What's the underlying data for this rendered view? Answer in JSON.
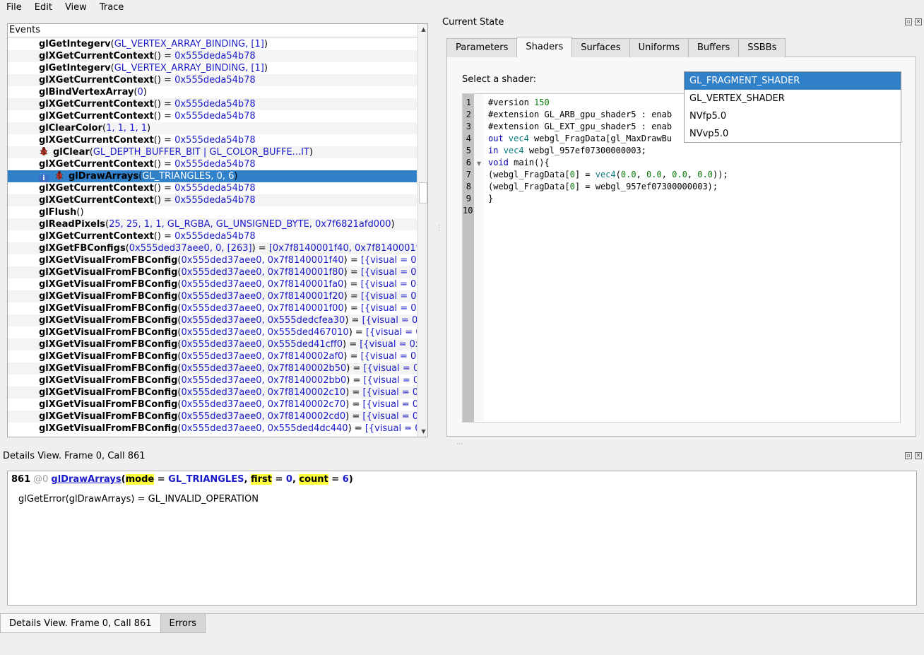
{
  "menubar": {
    "items": [
      "File",
      "Edit",
      "View",
      "Trace"
    ]
  },
  "events": {
    "header": "Events",
    "rows": [
      {
        "fn": "glGetIntegerv",
        "args": "GL_VERTEX_ARRAY_BINDING, [1]",
        "ret": ""
      },
      {
        "fn": "glXGetCurrentContext",
        "args": "",
        "ret": "0x555deda54b78"
      },
      {
        "fn": "glGetIntegerv",
        "args": "GL_VERTEX_ARRAY_BINDING, [1]",
        "ret": ""
      },
      {
        "fn": "glXGetCurrentContext",
        "args": "",
        "ret": "0x555deda54b78"
      },
      {
        "fn": "glBindVertexArray",
        "args": "0",
        "ret": ""
      },
      {
        "fn": "glXGetCurrentContext",
        "args": "",
        "ret": "0x555deda54b78"
      },
      {
        "fn": "glXGetCurrentContext",
        "args": "",
        "ret": "0x555deda54b78"
      },
      {
        "fn": "glClearColor",
        "args": "1, 1, 1, 1",
        "ret": ""
      },
      {
        "fn": "glXGetCurrentContext",
        "args": "",
        "ret": "0x555deda54b78"
      },
      {
        "fn": "glClear",
        "args": "GL_DEPTH_BUFFER_BIT | GL_COLOR_BUFFE...IT",
        "ret": "",
        "icon": "bug"
      },
      {
        "fn": "glXGetCurrentContext",
        "args": "",
        "ret": "0x555deda54b78"
      },
      {
        "fn": "glDrawArrays",
        "args": "GL_TRIANGLES, 0, 6",
        "ret": "",
        "icon": "info-bug",
        "selected": true
      },
      {
        "fn": "glXGetCurrentContext",
        "args": "",
        "ret": "0x555deda54b78"
      },
      {
        "fn": "glXGetCurrentContext",
        "args": "",
        "ret": "0x555deda54b78"
      },
      {
        "fn": "glFlush",
        "args": "",
        "ret": ""
      },
      {
        "fn": "glReadPixels",
        "args": "25, 25, 1, 1, GL_RGBA, GL_UNSIGNED_BYTE, 0x7f6821afd000",
        "ret": ""
      },
      {
        "fn": "glXGetCurrentContext",
        "args": "",
        "ret": "0x555deda54b78"
      },
      {
        "fn": "glXGetFBConfigs",
        "args": "0x555ded37aee0, 0, [263]",
        "ret": "[0x7f8140001f40, 0x7f8140001f"
      },
      {
        "fn": "glXGetVisualFromFBConfig",
        "args": "0x555ded37aee0, 0x7f8140001f40",
        "ret": "[{visual = 0"
      },
      {
        "fn": "glXGetVisualFromFBConfig",
        "args": "0x555ded37aee0, 0x7f8140001f80",
        "ret": "[{visual = 0"
      },
      {
        "fn": "glXGetVisualFromFBConfig",
        "args": "0x555ded37aee0, 0x7f8140001fa0",
        "ret": "[{visual = 0"
      },
      {
        "fn": "glXGetVisualFromFBConfig",
        "args": "0x555ded37aee0, 0x7f8140001f20",
        "ret": "[{visual = 0"
      },
      {
        "fn": "glXGetVisualFromFBConfig",
        "args": "0x555ded37aee0, 0x7f8140001f00",
        "ret": "[{visual = 0"
      },
      {
        "fn": "glXGetVisualFromFBConfig",
        "args": "0x555ded37aee0, 0x555dedcfea30",
        "ret": "[{visual = 0"
      },
      {
        "fn": "glXGetVisualFromFBConfig",
        "args": "0x555ded37aee0, 0x555ded467010",
        "ret": "[{visual = 0"
      },
      {
        "fn": "glXGetVisualFromFBConfig",
        "args": "0x555ded37aee0, 0x555ded41cff0",
        "ret": "[{visual = 0x"
      },
      {
        "fn": "glXGetVisualFromFBConfig",
        "args": "0x555ded37aee0, 0x7f8140002af0",
        "ret": "[{visual = 0"
      },
      {
        "fn": "glXGetVisualFromFBConfig",
        "args": "0x555ded37aee0, 0x7f8140002b50",
        "ret": "[{visual = 0"
      },
      {
        "fn": "glXGetVisualFromFBConfig",
        "args": "0x555ded37aee0, 0x7f8140002bb0",
        "ret": "[{visual = 0"
      },
      {
        "fn": "glXGetVisualFromFBConfig",
        "args": "0x555ded37aee0, 0x7f8140002c10",
        "ret": "[{visual = 0"
      },
      {
        "fn": "glXGetVisualFromFBConfig",
        "args": "0x555ded37aee0, 0x7f8140002c70",
        "ret": "[{visual = 0"
      },
      {
        "fn": "glXGetVisualFromFBConfig",
        "args": "0x555ded37aee0, 0x7f8140002cd0",
        "ret": "[{visual = 0"
      },
      {
        "fn": "glXGetVisualFromFBConfig",
        "args": "0x555ded37aee0, 0x555ded4dc440",
        "ret": "[{visual = 0"
      }
    ]
  },
  "current_state": {
    "title": "Current State",
    "tabs": [
      "Parameters",
      "Shaders",
      "Surfaces",
      "Uniforms",
      "Buffers",
      "SSBBs"
    ],
    "active_tab": "Shaders",
    "select_label": "Select a shader:",
    "dropdown_options": [
      "GL_FRAGMENT_SHADER",
      "GL_VERTEX_SHADER",
      "NVfp5.0",
      "NVvp5.0"
    ],
    "selected_option": "GL_FRAGMENT_SHADER",
    "line_numbers": [
      "1",
      "2",
      "3",
      "4",
      "5",
      "6",
      "7",
      "8",
      "9",
      "10"
    ],
    "code_lines": [
      "#version 150",
      "#extension GL_ARB_gpu_shader5 : enab",
      "#extension GL_EXT_gpu_shader5 : enab",
      "out vec4 webgl_FragData[gl_MaxDrawBu",
      "in vec4 webgl_957ef07300000003;",
      "void main(){",
      "(webgl_FragData[0] = vec4(0.0, 0.0, 0.0, 0.0));",
      "(webgl_FragData[0] = webgl_957ef07300000003);",
      "}",
      ""
    ]
  },
  "details": {
    "title": "Details View. Frame 0, Call 861",
    "call_number": "861",
    "frame": "@0",
    "function": "glDrawArrays",
    "params": [
      {
        "name": "mode",
        "value": "GL_TRIANGLES"
      },
      {
        "name": "first",
        "value": "0"
      },
      {
        "name": "count",
        "value": "6"
      }
    ],
    "error_line": "glGetError(glDrawArrays) = GL_INVALID_OPERATION"
  },
  "bottom_tabs": [
    "Details View. Frame 0, Call 861",
    "Errors"
  ],
  "colors": {
    "selection": "#3081c9",
    "link_blue": "#1a1ac8",
    "highlight": "#ffff3a"
  }
}
